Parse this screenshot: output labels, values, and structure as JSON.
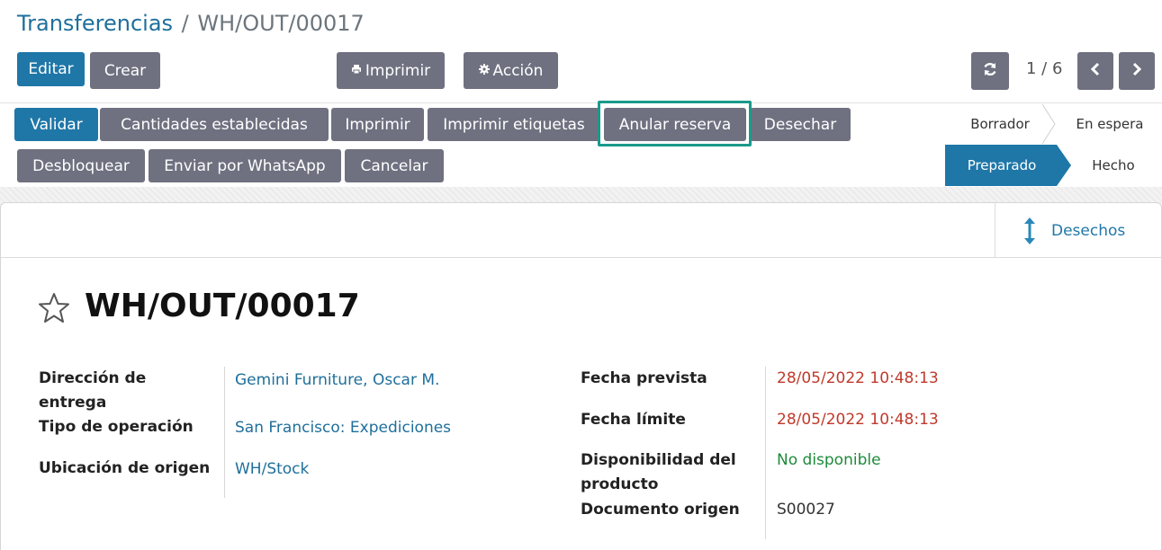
{
  "breadcrumb": {
    "parent": "Transferencias",
    "separator": "/",
    "current": "WH/OUT/00017"
  },
  "control_panel": {
    "edit_label": "Editar",
    "create_label": "Crear",
    "print_label": "Imprimir",
    "action_label": "Acción",
    "pager": "1 / 6"
  },
  "header_buttons": {
    "validate": "Validar",
    "set_quantities": "Cantidades establecidas",
    "print": "Imprimir",
    "print_labels": "Imprimir etiquetas",
    "unreserve": "Anular reserva",
    "scrap": "Desechar",
    "unlock": "Desbloquear",
    "whatsapp": "Enviar por WhatsApp",
    "cancel": "Cancelar"
  },
  "status": {
    "draft": "Borrador",
    "waiting": "En espera",
    "ready": "Preparado",
    "done": "Hecho"
  },
  "smart_button": {
    "label": "Desechos"
  },
  "record": {
    "title": "WH/OUT/00017",
    "left_fields": [
      {
        "label": "Dirección de entrega",
        "value": "Gemini Furniture, Oscar M."
      },
      {
        "label": "Tipo de operación",
        "value": "San Francisco: Expediciones"
      },
      {
        "label": "Ubicación de origen",
        "value": "WH/Stock"
      }
    ],
    "right_fields": [
      {
        "label": "Fecha prevista",
        "value": "28/05/2022 10:48:13"
      },
      {
        "label": "Fecha límite",
        "value": "28/05/2022 10:48:13"
      },
      {
        "label": "Disponibilidad del producto",
        "value": "No disponible"
      },
      {
        "label": "Documento origen",
        "value": "S00027"
      }
    ]
  },
  "colors": {
    "primary": "#1f77a8",
    "secondary": "#6f7180",
    "highlight": "#1a9a8c",
    "date_warning": "#c0392b",
    "availability": "#1e8a3a"
  }
}
